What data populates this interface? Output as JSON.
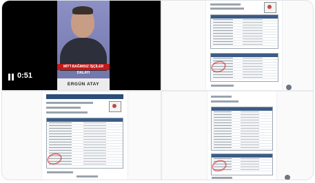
{
  "video": {
    "time": "0:51",
    "banner_text": "MİT'İ BAĞIMSIZ İŞÇİLER DALAYI",
    "name_strip": "ERGÜN ATAY"
  },
  "documents": [
    {
      "alt": "document-image-1"
    },
    {
      "alt": "document-image-2"
    },
    {
      "alt": "document-image-3"
    }
  ]
}
